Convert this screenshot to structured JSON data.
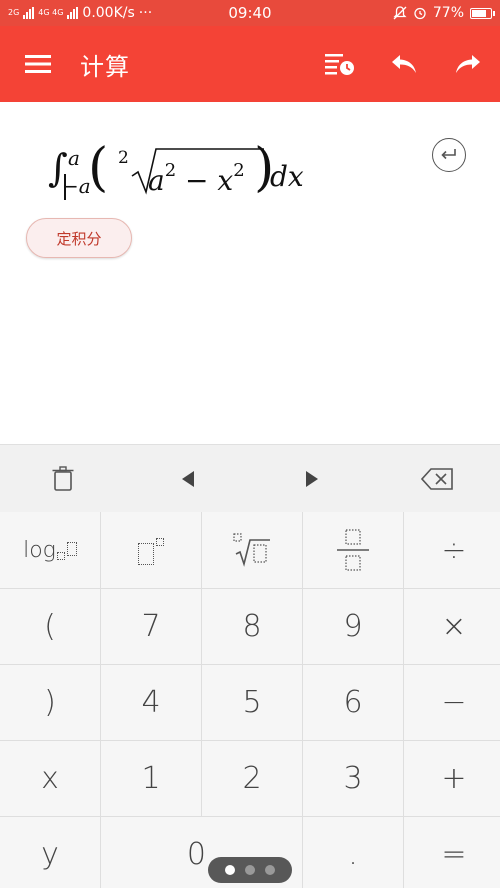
{
  "status_bar": {
    "net_left": "2G",
    "net_mid": "4G 4G",
    "speed": "0.00K/s",
    "dots": "···",
    "time": "09:40",
    "battery": "77%",
    "battery_level": 0.77
  },
  "app_bar": {
    "title": "计算",
    "menu_icon": "menu-icon",
    "history_icon": "history-icon",
    "undo_icon": "undo-icon",
    "redo_icon": "redo-icon"
  },
  "expression": {
    "integral": "∫",
    "upper_limit": "a",
    "lower_limit": "−a",
    "root_index": "2",
    "radicand_a": "a",
    "exp_a": "2",
    "minus": " − ",
    "radicand_x": "x",
    "exp_x": "2",
    "dx": "dx"
  },
  "result_chip": {
    "label": "定积分"
  },
  "edit_bar": {
    "delete_icon": "trash-icon",
    "left_icon": "arrow-left-icon",
    "right_icon": "arrow-right-icon",
    "backspace_icon": "backspace-icon"
  },
  "keypad": {
    "log": "log",
    "open_paren": "(",
    "close_paren": ")",
    "x": "x",
    "y": "y",
    "k7": "7",
    "k8": "8",
    "k9": "9",
    "k4": "4",
    "k5": "5",
    "k6": "6",
    "k1": "1",
    "k2": "2",
    "k3": "3",
    "k0": "0",
    "dot": ".",
    "divide": "÷",
    "multiply": "×",
    "minus": "−",
    "plus": "+",
    "equals": "="
  },
  "pager": {
    "pages": 3,
    "active": 0
  },
  "colors": {
    "accent": "#f44336",
    "status": "#e84a3c",
    "chip_text": "#c0392b"
  }
}
